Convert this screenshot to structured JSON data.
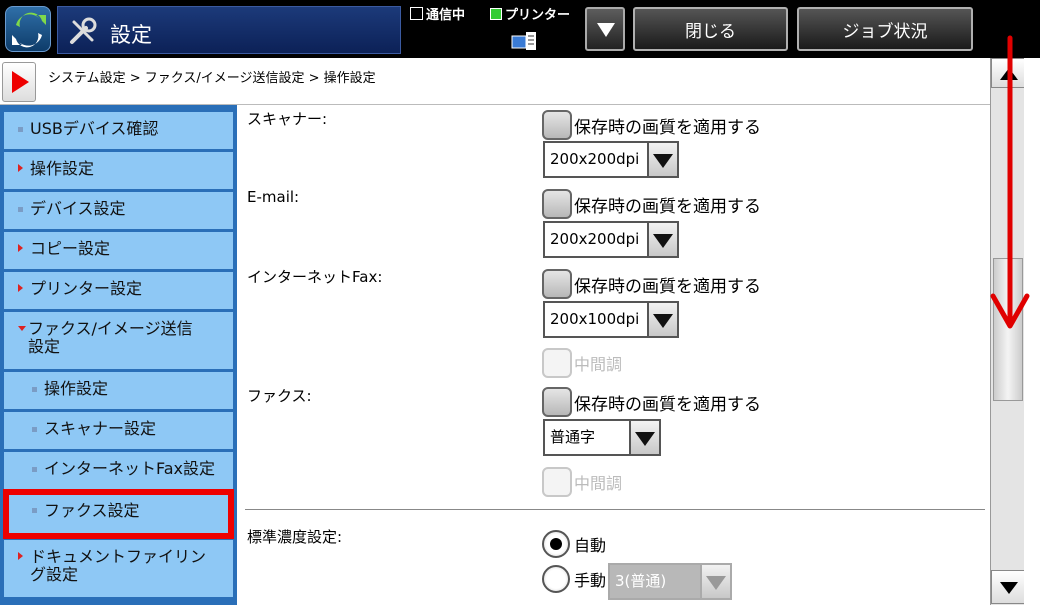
{
  "header": {
    "title": "設定",
    "status_comm": "通信中",
    "status_printer": "プリンター",
    "close_label": "閉じる",
    "job_status_label": "ジョブ状況"
  },
  "breadcrumb": "システム設定 > ファクス/イメージ送信設定 > 操作設定",
  "sidebar": {
    "items": [
      {
        "label": "USBデバイス確認",
        "mark": "dot"
      },
      {
        "label": "操作設定",
        "mark": "arrow"
      },
      {
        "label": "デバイス設定",
        "mark": "dot"
      },
      {
        "label": "コピー設定",
        "mark": "arrow"
      },
      {
        "label": "プリンター設定",
        "mark": "arrow"
      },
      {
        "label": "ファクス/イメージ送信\n設定",
        "mark": "arrow-down"
      },
      {
        "label": "操作設定",
        "mark": "dot"
      },
      {
        "label": "スキャナー設定",
        "mark": "dot"
      },
      {
        "label": "インターネットFax設定",
        "mark": "dot"
      },
      {
        "label": "ファクス設定",
        "mark": "dot"
      },
      {
        "label": "ドキュメントファイリン\nグ設定",
        "mark": "arrow"
      }
    ]
  },
  "main": {
    "scanner": {
      "label": "スキャナー:",
      "apply_label": "保存時の画質を適用する",
      "resolution": "200x200dpi"
    },
    "email": {
      "label": "E-mail:",
      "apply_label": "保存時の画質を適用する",
      "resolution": "200x200dpi"
    },
    "ifax": {
      "label": "インターネットFax:",
      "apply_label": "保存時の画質を適用する",
      "resolution": "200x100dpi",
      "halftone_label": "中間調"
    },
    "fax": {
      "label": "ファクス:",
      "apply_label": "保存時の画質を適用する",
      "resolution": "普通字",
      "halftone_label": "中間調"
    },
    "density": {
      "label": "標準濃度設定:",
      "auto_label": "自動",
      "manual_label": "手動",
      "manual_value": "3(普通)"
    }
  },
  "colors": {
    "accent_red": "#e00000",
    "sidebar_bg": "#2a6fb8",
    "sidebar_item": "#8ec8f5"
  },
  "icons": [
    "app-icon",
    "tool-icon",
    "printer-icon",
    "back-arrow-icon",
    "chevron-down-icon",
    "scroll-up-icon",
    "scroll-down-icon"
  ]
}
